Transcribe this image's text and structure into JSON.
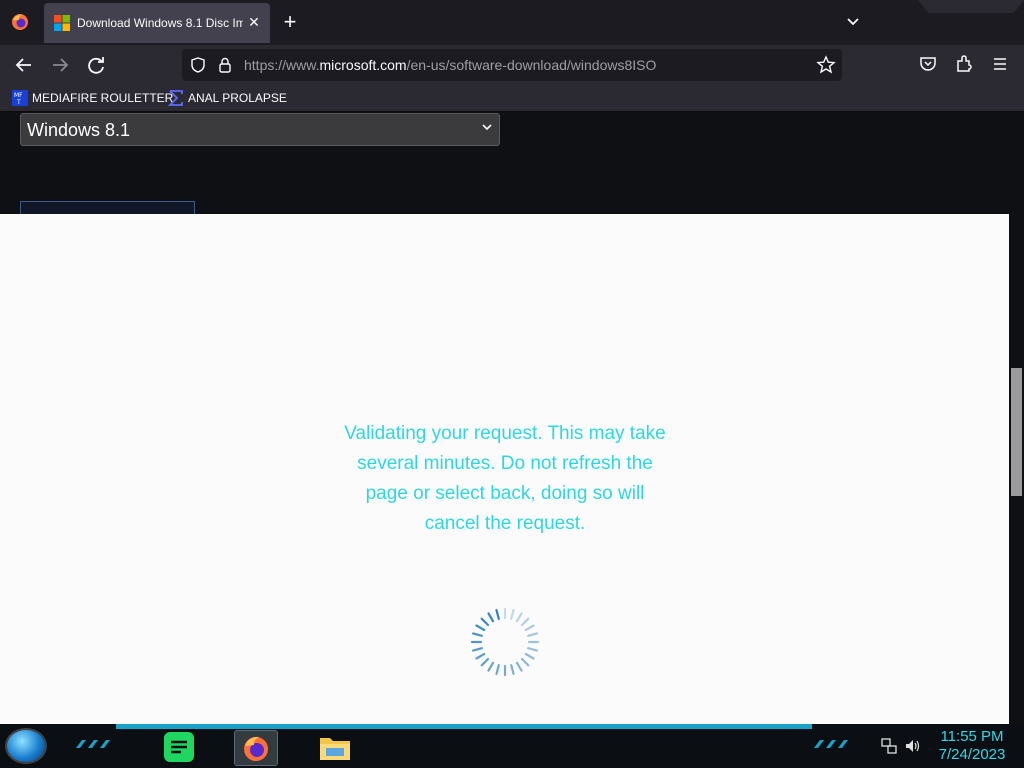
{
  "browser": {
    "tab": {
      "title": "Download Windows 8.1 Disc Im",
      "favicon": "microsoft-logo-icon",
      "close_label": "✕"
    },
    "new_tab_label": "+",
    "url": {
      "prefix": "https://www.",
      "domain": "microsoft.com",
      "path": "/en-us/software-download/windows8ISO"
    },
    "bookmarks": [
      {
        "label": "MEDIAFIRE ROULETTER",
        "icon": "mediafire-icon"
      },
      {
        "label": "ANAL PROLAPSE",
        "icon": "sigma-icon"
      }
    ],
    "colors": {
      "chrome_dark": "#1c1b22",
      "chrome": "#2b2a33",
      "active_tab": "#42414d"
    }
  },
  "page": {
    "select_value": "Windows 8.1",
    "validation_message": "Validating your request. This may take several minutes. Do not refresh the page or select back, doing so will cancel the request.",
    "message_color": "#2ed7e0"
  },
  "taskbar": {
    "time": "11:55 PM",
    "date": "7/24/2023",
    "apps": [
      "spotify-icon",
      "firefox-icon",
      "file-explorer-icon"
    ],
    "accent": "#18a2c7"
  }
}
